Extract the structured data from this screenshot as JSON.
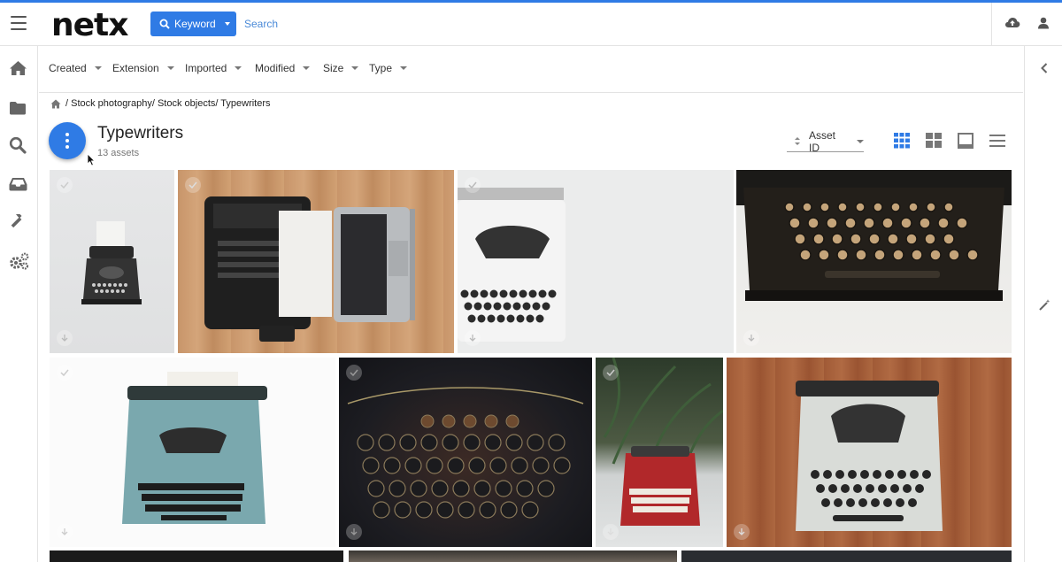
{
  "header": {
    "logo": "netx",
    "search_mode_label": "Keyword",
    "search_placeholder": "Search"
  },
  "filters": [
    "Created",
    "Extension",
    "Imported",
    "Modified",
    "Size",
    "Type"
  ],
  "breadcrumb": {
    "path": "/ Stock photography/ Stock objects/ Typewriters"
  },
  "folder": {
    "title": "Typewriters",
    "asset_count": "13 assets"
  },
  "sort": {
    "label": "Asset ID"
  },
  "colors": {
    "accent": "#2f7be5",
    "nav_icon": "#666666",
    "active_view": "#2f7be5"
  },
  "views": [
    "grid-view-icon",
    "mosaic-view-icon",
    "single-view-icon",
    "list-view-icon"
  ],
  "leftnav": [
    "home-icon",
    "folder-icon",
    "search-icon",
    "inbox-icon",
    "tools-icon",
    "settings-icon"
  ],
  "assets": [
    {
      "thumb": "typewriter-white-background"
    },
    {
      "thumb": "typewriter-and-laptop-on-wood"
    },
    {
      "thumb": "white-typewriter-closeup"
    },
    {
      "thumb": "typewriter-keys-dark"
    },
    {
      "thumb": "blue-typewriter"
    },
    {
      "thumb": "smith-corona-keys"
    },
    {
      "thumb": "red-typewriter-with-plants"
    },
    {
      "thumb": "white-typewriter-on-wood"
    },
    {
      "thumb": "typewriter-partial-1"
    },
    {
      "thumb": "typewriter-partial-2"
    },
    {
      "thumb": "typewriter-partial-3"
    }
  ]
}
